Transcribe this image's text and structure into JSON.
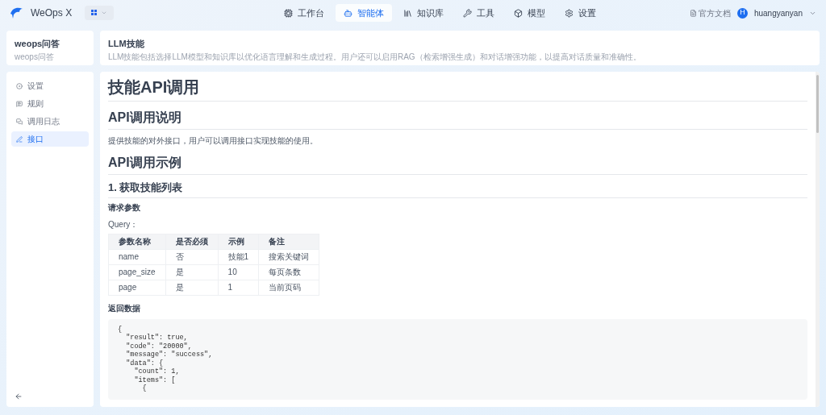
{
  "app": {
    "name": "WeOps X"
  },
  "top_nav": [
    {
      "label": "工作台",
      "selected": false
    },
    {
      "label": "智能体",
      "selected": true
    },
    {
      "label": "知识库",
      "selected": false
    },
    {
      "label": "工具",
      "selected": false
    },
    {
      "label": "模型",
      "selected": false
    },
    {
      "label": "设置",
      "selected": false
    }
  ],
  "header_right": {
    "docs_link": "官方文档",
    "avatar_letter": "H",
    "username": "huangyanyan"
  },
  "skill": {
    "title": "weops问答",
    "subtitle": "weops问答"
  },
  "sidebar": {
    "items": [
      {
        "label": "设置",
        "selected": false
      },
      {
        "label": "规则",
        "selected": false
      },
      {
        "label": "调用日志",
        "selected": false
      },
      {
        "label": "接口",
        "selected": true
      }
    ]
  },
  "page_header": {
    "title": "LLM技能",
    "description": "LLM技能包括选择LLM模型和知识库以优化语言理解和生成过程。用户还可以启用RAG（检索增强生成）和对话增强功能，以提高对话质量和准确性。"
  },
  "doc": {
    "title": "技能API调用",
    "sections": [
      {
        "kind": "h2",
        "text": "API调用说明"
      },
      {
        "kind": "p",
        "text": "提供技能的对外接口，用户可以调用接口实现技能的使用。"
      },
      {
        "kind": "h2",
        "text": "API调用示例"
      },
      {
        "kind": "h3",
        "text": "1. 获取技能列表"
      },
      {
        "kind": "h4",
        "text": "请求参数"
      },
      {
        "kind": "p",
        "text": "Query："
      },
      {
        "kind": "table",
        "columns": [
          "参数名称",
          "是否必须",
          "示例",
          "备注"
        ],
        "rows": [
          [
            "name",
            "否",
            "技能1",
            "搜索关键词"
          ],
          [
            "page_size",
            "是",
            "10",
            "每页条数"
          ],
          [
            "page",
            "是",
            "1",
            "当前页码"
          ]
        ]
      },
      {
        "kind": "h4",
        "text": "返回数据"
      },
      {
        "kind": "code",
        "lines": [
          "{",
          "  \"result\": true,",
          "  \"code\": \"20000\",",
          "  \"message\": \"success\",",
          "  \"data\": {",
          "    \"count\": 1,",
          "    \"items\": [",
          "      {"
        ]
      }
    ]
  }
}
